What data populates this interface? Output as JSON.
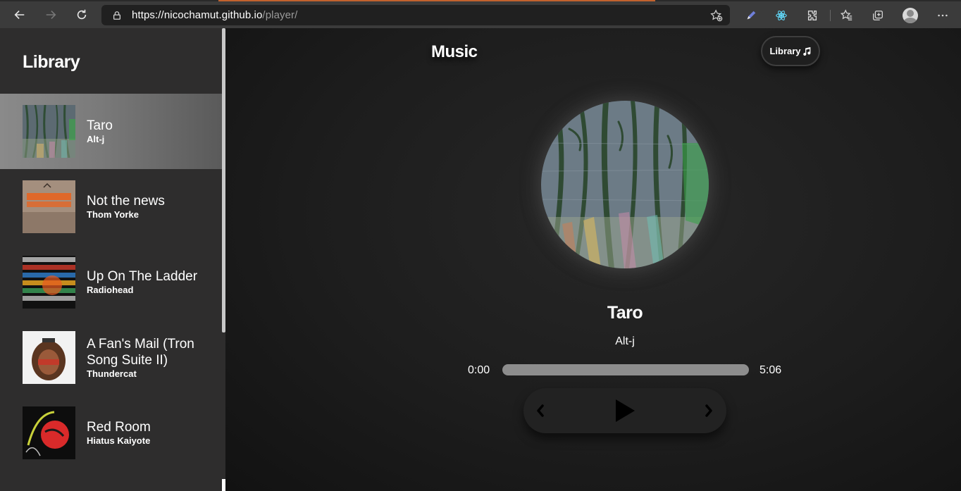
{
  "browser": {
    "url_host": "https://nicochamut.github.io",
    "url_path": "/player/",
    "icons": [
      "back-icon",
      "forward-icon",
      "refresh-icon",
      "lock-icon",
      "add-favorite-icon",
      "pen-extension-icon",
      "react-extension-icon",
      "extensions-icon",
      "favorites-icon",
      "collections-icon",
      "profile-avatar",
      "more-icon"
    ]
  },
  "sidebar": {
    "title": "Library",
    "songs": [
      {
        "title": "Taro",
        "artist": "Alt-j",
        "active": true
      },
      {
        "title": "Not the news",
        "artist": "Thom Yorke",
        "active": false
      },
      {
        "title": "Up On The Ladder",
        "artist": "Radiohead",
        "active": false
      },
      {
        "title": "A Fan's Mail (Tron Song Suite II)",
        "artist": "Thundercat",
        "active": false
      },
      {
        "title": "Red Room",
        "artist": "Hiatus Kaiyote",
        "active": false
      }
    ]
  },
  "main": {
    "heading": "Music",
    "library_button": "Library",
    "now_playing": {
      "title": "Taro",
      "artist": "Alt-j"
    },
    "time_current": "0:00",
    "time_total": "5:06",
    "progress": 0
  },
  "colors": {
    "accent": "#c2622e",
    "sidebar_bg": "#2e2d2d",
    "active_item": "#8a8a8a"
  }
}
